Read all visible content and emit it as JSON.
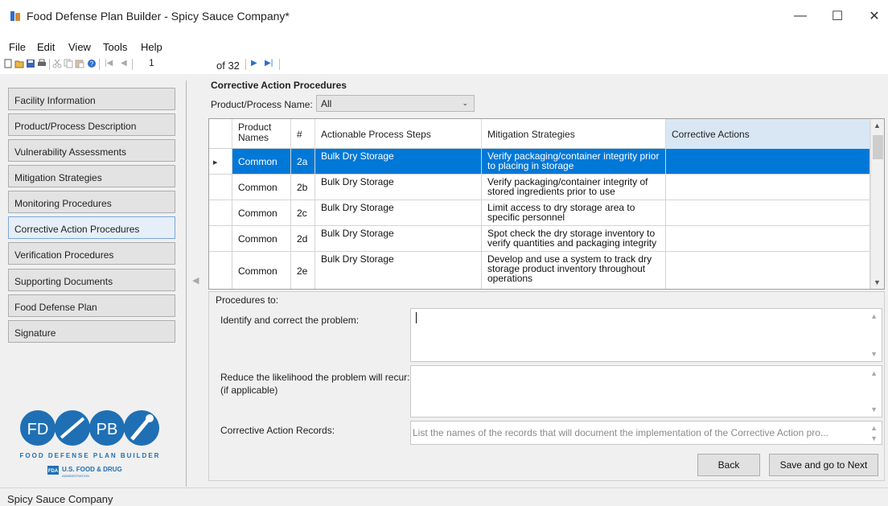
{
  "window": {
    "title": "Food Defense Plan Builder - Spicy Sauce Company*",
    "controls": {
      "minimize": "—",
      "maximize": "☐",
      "close": "✕"
    }
  },
  "menu": [
    "File",
    "Edit",
    "View",
    "Tools",
    "Help"
  ],
  "toolbar": {
    "icons": [
      "new-icon",
      "open-icon",
      "save-icon",
      "print-icon",
      "cut-icon",
      "copy-icon",
      "paste-icon",
      "help-icon",
      "first-page-icon",
      "prev-page-icon",
      "next-page-icon",
      "last-page-icon"
    ],
    "page_current": "1",
    "page_of": "of 32",
    "nav": {
      "first": "|◀",
      "prev": "◀",
      "next": "▶",
      "last": "▶|"
    }
  },
  "sidebar": {
    "items": [
      {
        "label": "Facility Information"
      },
      {
        "label": "Product/Process Description"
      },
      {
        "label": "Vulnerability Assessments"
      },
      {
        "label": "Mitigation Strategies"
      },
      {
        "label": "Monitoring Procedures"
      },
      {
        "label": "Corrective Action Procedures",
        "active": true
      },
      {
        "label": "Verification Procedures"
      },
      {
        "label": "Supporting Documents"
      },
      {
        "label": "Food Defense Plan"
      },
      {
        "label": "Signature"
      }
    ],
    "logo": {
      "line1": "FOOD DEFENSE PLAN BUILDER",
      "fd": "FD",
      "pb": "PB",
      "fda_badge": "FDA",
      "agency": "U.S. FOOD & DRUG",
      "agency_sub": "ADMINISTRATION"
    },
    "collapse_arrow": "◀"
  },
  "main": {
    "section_title": "Corrective Action Procedures",
    "filter_label": "Product/Process Name:",
    "filter_value": "All",
    "grid": {
      "columns": [
        "Product Names",
        "#",
        "Actionable Process Steps",
        "Mitigation Strategies",
        "Corrective Actions"
      ],
      "rows": [
        {
          "product": "Common",
          "num": "2a",
          "step": "Bulk Dry Storage",
          "mitigation": "Verify packaging/container integrity prior to placing in storage",
          "corrective": "",
          "selected": true
        },
        {
          "product": "Common",
          "num": "2b",
          "step": "Bulk Dry Storage",
          "mitigation": "Verify packaging/container integrity of stored ingredients prior to use",
          "corrective": ""
        },
        {
          "product": "Common",
          "num": "2c",
          "step": "Bulk Dry Storage",
          "mitigation": "Limit access to dry storage area to specific personnel",
          "corrective": ""
        },
        {
          "product": "Common",
          "num": "2d",
          "step": "Bulk Dry Storage",
          "mitigation": "Spot check the dry storage inventory to verify quantities and packaging integrity",
          "corrective": ""
        },
        {
          "product": "Common",
          "num": "2e",
          "step": "Bulk Dry Storage",
          "mitigation": "Develop and use a system to track dry storage product inventory throughout operations",
          "corrective": ""
        }
      ]
    },
    "procedures": {
      "heading": "Procedures to:",
      "identify_label": "Identify and correct the problem:",
      "identify_value": "",
      "reduce_label_1": "Reduce the likelihood the problem will recur:",
      "reduce_label_2": "(if applicable)",
      "reduce_value": "",
      "records_label": "Corrective Action Records:",
      "records_placeholder": "List the names of the records that will document the implementation of the Corrective Action pro..."
    },
    "buttons": {
      "back": "Back",
      "save_next": "Save and go to Next"
    }
  },
  "status": {
    "text": "Spicy Sauce Company"
  },
  "colors": {
    "selection": "#0078d7",
    "accent_blue": "#2e6ccf",
    "logo_blue": "#1f6fb5"
  }
}
